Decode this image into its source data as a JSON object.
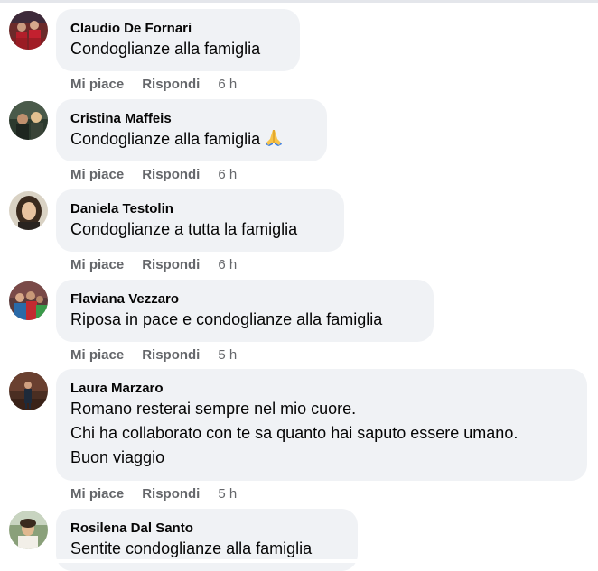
{
  "actions": {
    "like_label": "Mi piace",
    "reply_label": "Rispondi"
  },
  "comments": [
    {
      "author": "Claudio De Fornari",
      "lines": [
        "Condoglianze alla famiglia"
      ],
      "time": "6 h",
      "avatar_icon": "profile-photo"
    },
    {
      "author": "Cristina Maffeis",
      "lines": [
        "Condoglianze alla famiglia"
      ],
      "emoji": "folded-hands-icon",
      "time": "6 h",
      "avatar_icon": "profile-photo"
    },
    {
      "author": "Daniela Testolin",
      "lines": [
        "Condoglianze a tutta la famiglia"
      ],
      "time": "6 h",
      "avatar_icon": "profile-photo"
    },
    {
      "author": "Flaviana Vezzaro",
      "lines": [
        "Riposa in pace e condoglianze alla famiglia"
      ],
      "time": "5 h",
      "avatar_icon": "profile-photo"
    },
    {
      "author": "Laura Marzaro",
      "lines": [
        "Romano resterai sempre nel mio cuore.",
        "Chi ha collaborato con te sa quanto hai saputo essere umano.",
        "Buon viaggio"
      ],
      "time": "5 h",
      "avatar_icon": "profile-photo"
    },
    {
      "author": "Rosilena Dal Santo",
      "lines": [
        "Sentite condoglianze alla famiglia"
      ],
      "avatar_icon": "profile-photo"
    }
  ]
}
